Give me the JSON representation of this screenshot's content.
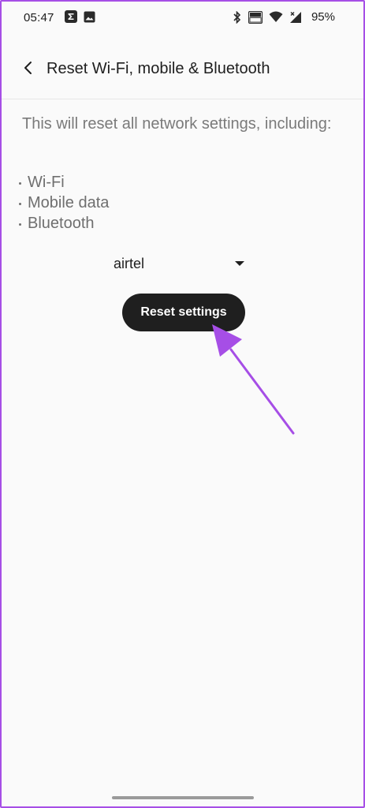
{
  "status_bar": {
    "time": "05:47",
    "battery": "95%",
    "left_icons": [
      "sigma-notification-icon",
      "image-notification-icon"
    ],
    "right_icons": [
      "bluetooth-icon",
      "volte-icon",
      "wifi-icon",
      "signal-icon"
    ]
  },
  "app_bar": {
    "title": "Reset Wi-Fi, mobile & Bluetooth",
    "back_icon": "chevron-left-icon"
  },
  "content": {
    "description": "This will reset all network settings, including:",
    "items": [
      {
        "label": "Wi-Fi"
      },
      {
        "label": "Mobile data"
      },
      {
        "label": "Bluetooth"
      }
    ],
    "sim_selector": {
      "selected": "airtel"
    },
    "reset_button_label": "Reset settings"
  },
  "colors": {
    "annotation_arrow": "#a64ee6",
    "frame_border": "#a64ee6",
    "button_bg": "#1f1f1f",
    "background": "#fafafa"
  }
}
